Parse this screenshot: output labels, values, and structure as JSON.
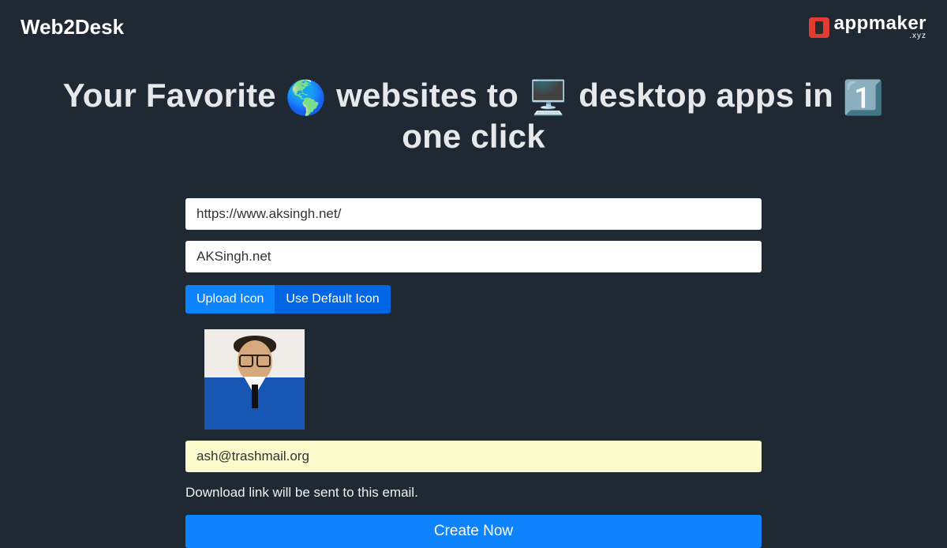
{
  "header": {
    "brand": "Web2Desk",
    "logo_text": "appmaker",
    "logo_sub": ".xyz"
  },
  "hero": {
    "text_pre": "Your Favorite ",
    "emoji_globe": "🌎",
    "text_mid1": " websites to ",
    "emoji_desktop": "🖥️",
    "text_mid2": " desktop apps in ",
    "emoji_one": "1️⃣",
    "text_post": " one click"
  },
  "form": {
    "url_value": "https://www.aksingh.net/",
    "name_value": "AKSingh.net",
    "upload_label": "Upload Icon",
    "default_label": "Use Default Icon",
    "email_value": "ash@trashmail.org",
    "email_help": "Download link will be sent to this email.",
    "submit_label": "Create Now"
  }
}
